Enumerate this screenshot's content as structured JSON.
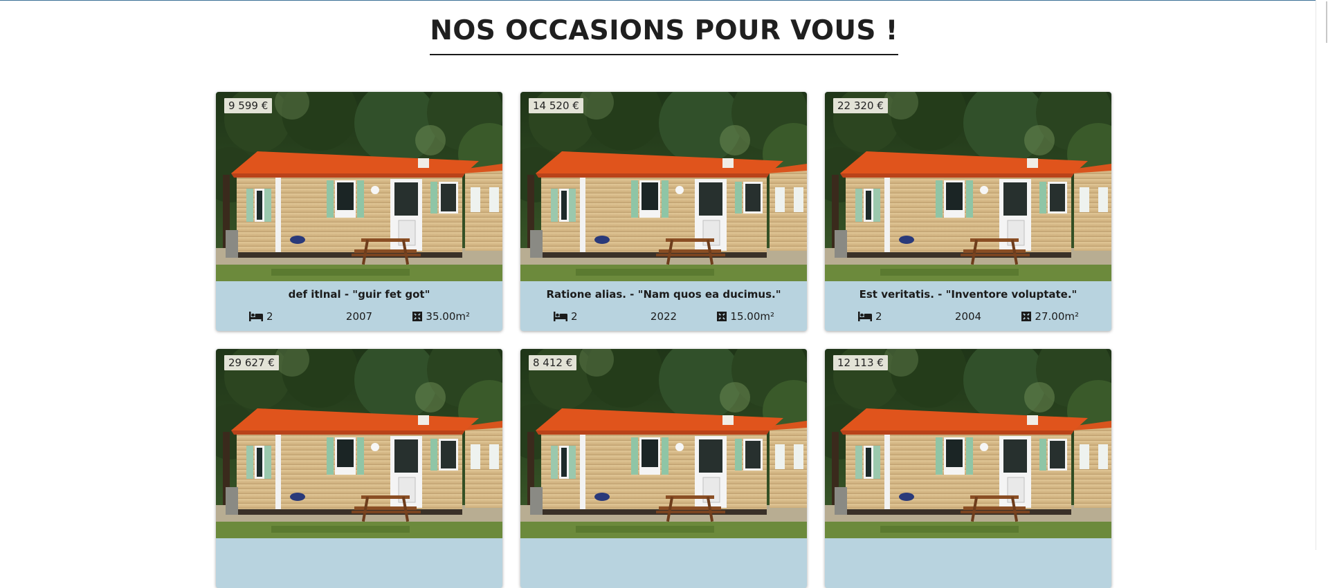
{
  "header": {
    "title": "NOS OCCASIONS POUR VOUS !"
  },
  "listings": [
    {
      "price": "9 599 €",
      "title": "def itlnal - \"guir fet got\"",
      "beds": "2",
      "year": "2007",
      "area": "35.00m²"
    },
    {
      "price": "14 520 €",
      "title": "Ratione alias. - \"Nam quos ea ducimus.\"",
      "beds": "2",
      "year": "2022",
      "area": "15.00m²"
    },
    {
      "price": "22 320 €",
      "title": "Est veritatis. - \"Inventore voluptate.\"",
      "beds": "2",
      "year": "2004",
      "area": "27.00m²"
    },
    {
      "price": "29 627 €",
      "title": "",
      "beds": "",
      "year": "",
      "area": ""
    },
    {
      "price": "8 412 €",
      "title": "",
      "beds": "",
      "year": "",
      "area": ""
    },
    {
      "price": "12 113 €",
      "title": "",
      "beds": "",
      "year": "",
      "area": ""
    }
  ],
  "icons": {
    "beds": "bed-icon",
    "area": "surface-area-icon"
  },
  "colors": {
    "card_info_bg": "#b8d3df",
    "price_badge_bg": "#e3e3d7",
    "roof": "#e0541c",
    "siding": "#dcc08f",
    "shutters": "#8fc5a6"
  }
}
